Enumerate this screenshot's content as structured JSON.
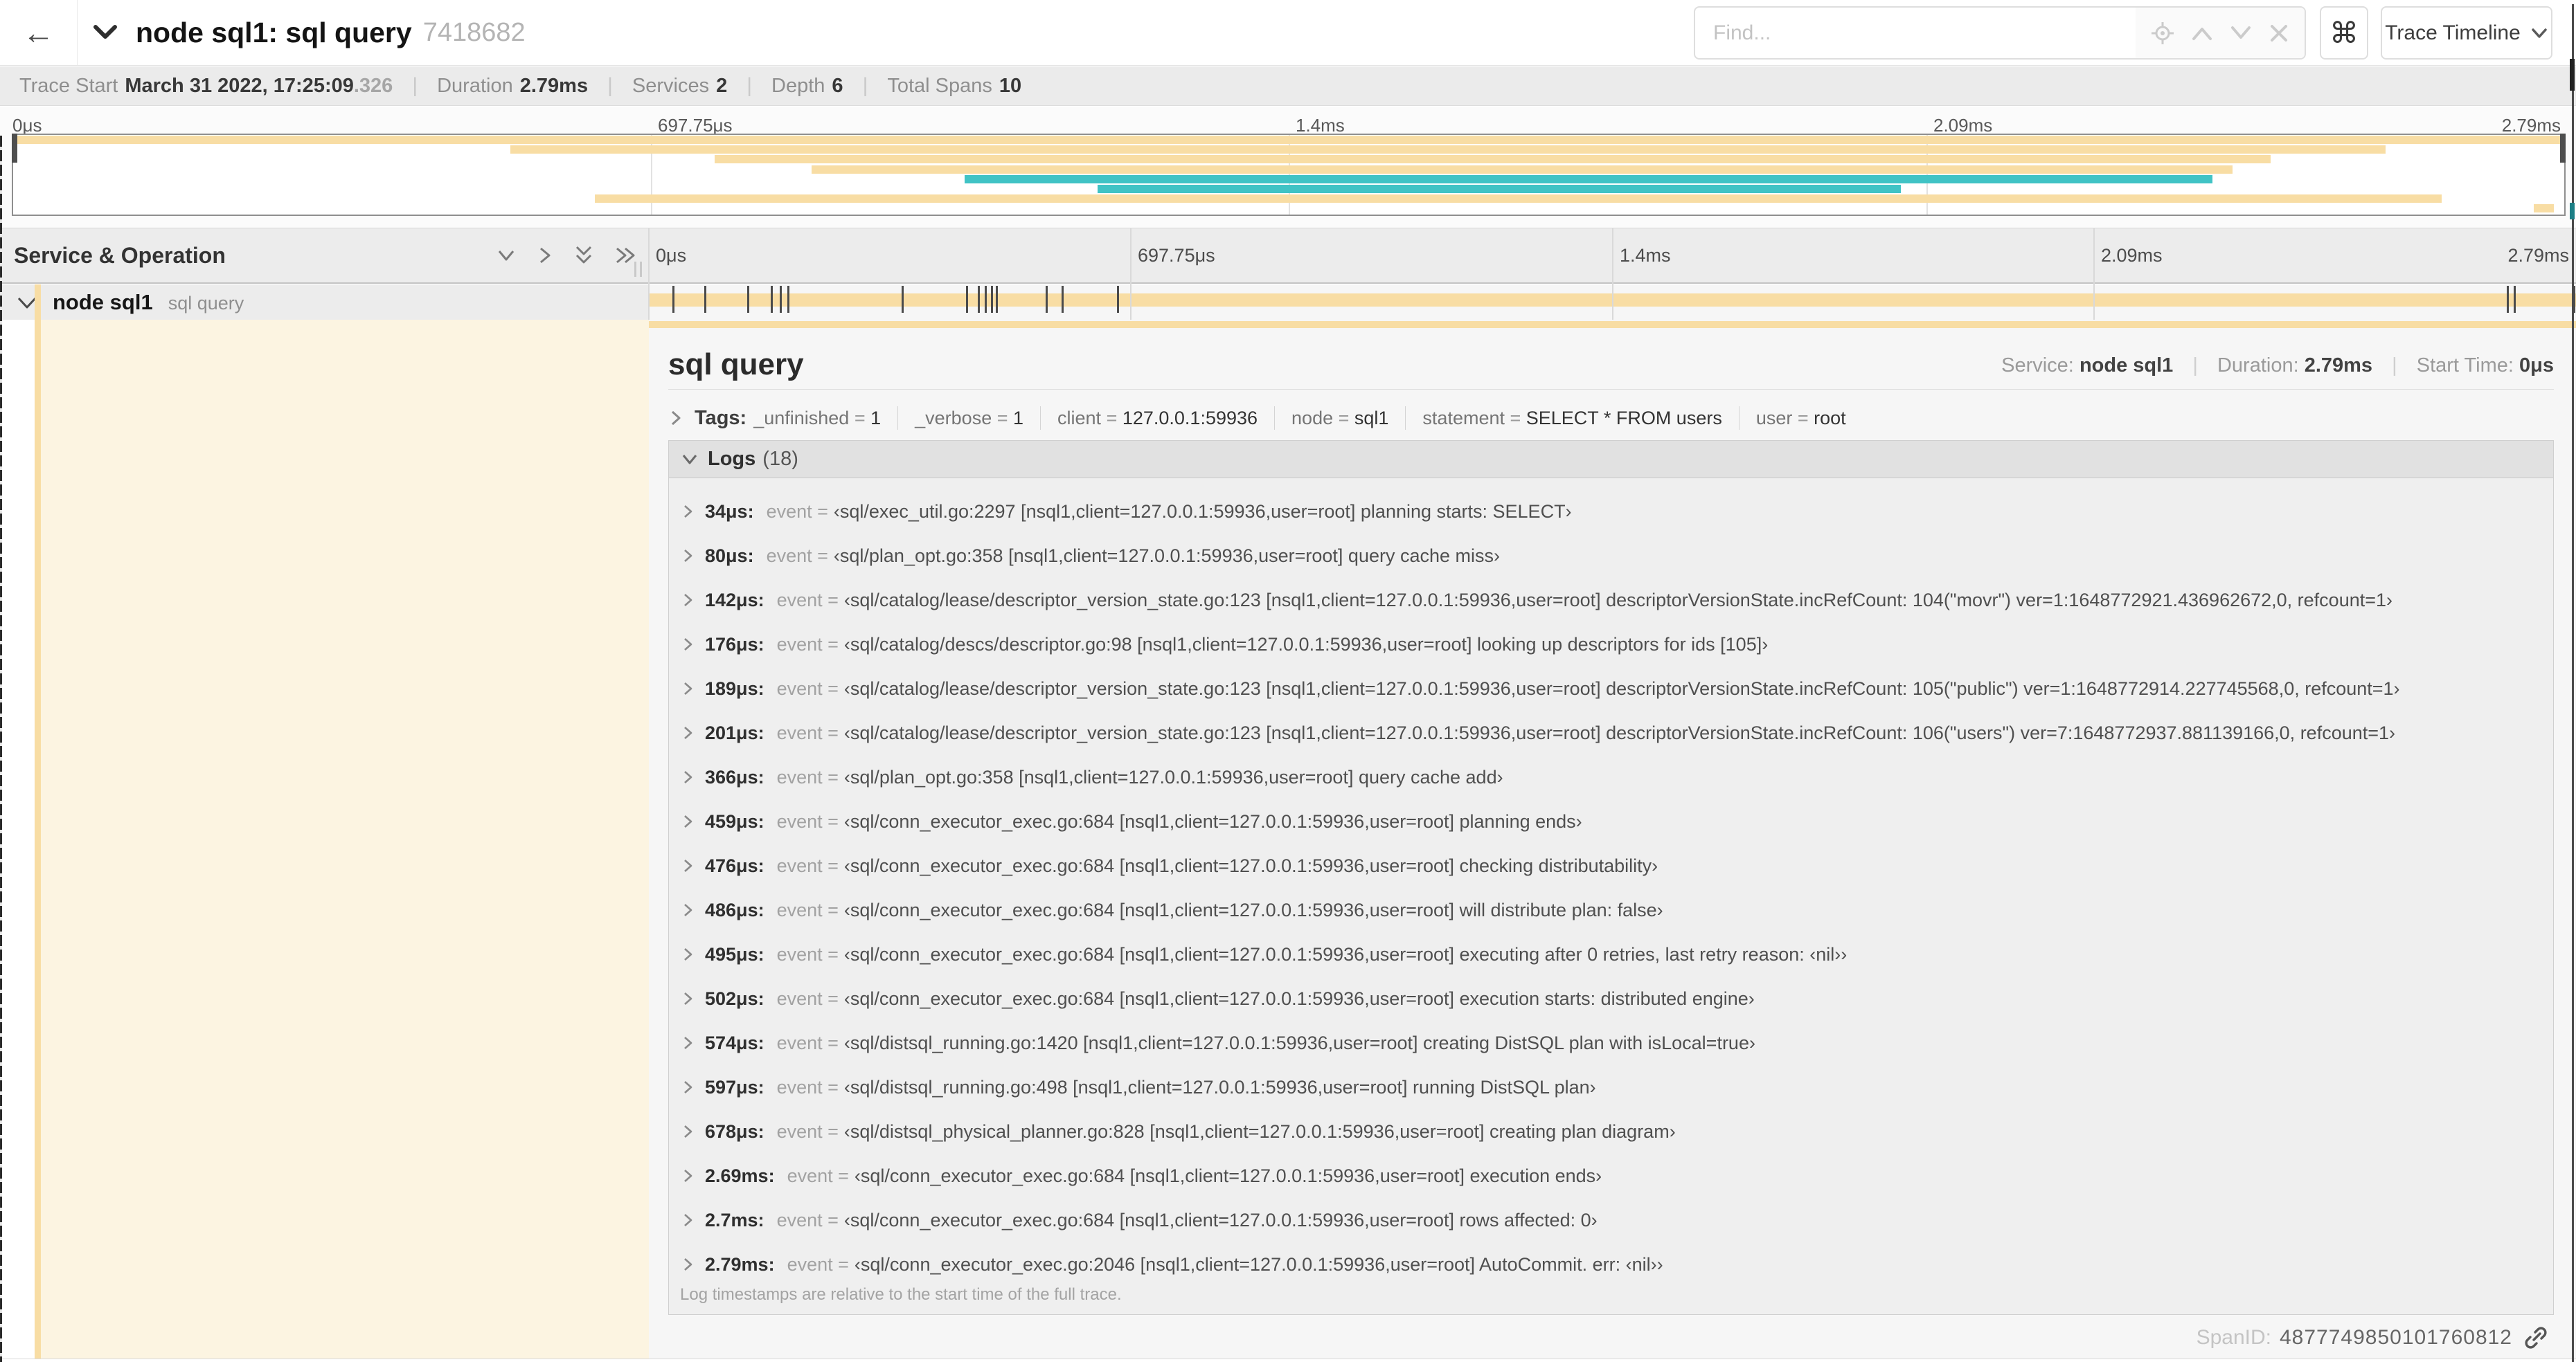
{
  "header": {
    "back": "←",
    "title": "node sql1: sql query",
    "trace_id": "7418682",
    "find_placeholder": "Find...",
    "shortcut": "⌘",
    "view_select": "Trace Timeline"
  },
  "trace_info": {
    "trace_start_label": "Trace Start",
    "trace_start_date": "March 31 2022, 17:25:09",
    "trace_start_frac": ".326",
    "duration_label": "Duration",
    "duration": "2.79ms",
    "services_label": "Services",
    "services": "2",
    "depth_label": "Depth",
    "depth": "6",
    "total_spans_label": "Total Spans",
    "total_spans": "10"
  },
  "minimap": {
    "ticks": [
      "0μs",
      "697.75μs",
      "1.4ms",
      "2.09ms",
      "2.79ms"
    ],
    "spans": [
      {
        "row": 0,
        "start": 0.0,
        "end": 1.0,
        "color": "tan"
      },
      {
        "row": 1,
        "start": 0.195,
        "end": 0.93,
        "color": "tan"
      },
      {
        "row": 2,
        "start": 0.275,
        "end": 0.885,
        "color": "tan"
      },
      {
        "row": 3,
        "start": 0.313,
        "end": 0.87,
        "color": "tan"
      },
      {
        "row": 4,
        "start": 0.373,
        "end": 0.862,
        "color": "teal"
      },
      {
        "row": 5,
        "start": 0.425,
        "end": 0.74,
        "color": "teal"
      },
      {
        "row": 6,
        "start": 0.228,
        "end": 0.952,
        "color": "tan"
      },
      {
        "row": 7,
        "start": 0.988,
        "end": 0.996,
        "color": "tan"
      }
    ]
  },
  "timeline": {
    "left_header": "Service & Operation",
    "ticks": [
      "0μs",
      "697.75μs",
      "1.4ms",
      "2.09ms",
      "2.79ms"
    ]
  },
  "row": {
    "service": "node sql1",
    "operation": "sql query"
  },
  "span_bar": {
    "duration_us": 2790,
    "log_ticks_us": [
      34,
      80,
      142,
      176,
      189,
      201,
      366,
      459,
      476,
      486,
      495,
      502,
      574,
      597,
      678,
      2690,
      2700,
      2786
    ]
  },
  "detail": {
    "title": "sql query",
    "service_label": "Service:",
    "service": "node sql1",
    "duration_label": "Duration:",
    "duration": "2.79ms",
    "start_label": "Start Time:",
    "start": "0μs",
    "tags_label": "Tags:",
    "tags": [
      {
        "key": "_unfinished",
        "value": "1"
      },
      {
        "key": "_verbose",
        "value": "1"
      },
      {
        "key": "client",
        "value": "127.0.0.1:59936"
      },
      {
        "key": "node",
        "value": "sql1"
      },
      {
        "key": "statement",
        "value": "SELECT * FROM users"
      },
      {
        "key": "user",
        "value": "root"
      }
    ],
    "logs_label": "Logs",
    "logs_count": "(18)",
    "event_key": "event",
    "logs": [
      {
        "t": "34μs:",
        "msg": "‹sql/exec_util.go:2297 [nsql1,client=127.0.0.1:59936,user=root] planning starts: SELECT›"
      },
      {
        "t": "80μs:",
        "msg": "‹sql/plan_opt.go:358 [nsql1,client=127.0.0.1:59936,user=root] query cache miss›"
      },
      {
        "t": "142μs:",
        "msg": "‹sql/catalog/lease/descriptor_version_state.go:123 [nsql1,client=127.0.0.1:59936,user=root] descriptorVersionState.incRefCount: 104(\"movr\") ver=1:1648772921.436962672,0, refcount=1›"
      },
      {
        "t": "176μs:",
        "msg": "‹sql/catalog/descs/descriptor.go:98 [nsql1,client=127.0.0.1:59936,user=root] looking up descriptors for ids [105]›"
      },
      {
        "t": "189μs:",
        "msg": "‹sql/catalog/lease/descriptor_version_state.go:123 [nsql1,client=127.0.0.1:59936,user=root] descriptorVersionState.incRefCount: 105(\"public\") ver=1:1648772914.227745568,0, refcount=1›"
      },
      {
        "t": "201μs:",
        "msg": "‹sql/catalog/lease/descriptor_version_state.go:123 [nsql1,client=127.0.0.1:59936,user=root] descriptorVersionState.incRefCount: 106(\"users\") ver=7:1648772937.881139166,0, refcount=1›"
      },
      {
        "t": "366μs:",
        "msg": "‹sql/plan_opt.go:358 [nsql1,client=127.0.0.1:59936,user=root] query cache add›"
      },
      {
        "t": "459μs:",
        "msg": "‹sql/conn_executor_exec.go:684 [nsql1,client=127.0.0.1:59936,user=root] planning ends›"
      },
      {
        "t": "476μs:",
        "msg": "‹sql/conn_executor_exec.go:684 [nsql1,client=127.0.0.1:59936,user=root] checking distributability›"
      },
      {
        "t": "486μs:",
        "msg": "‹sql/conn_executor_exec.go:684 [nsql1,client=127.0.0.1:59936,user=root] will distribute plan: false›"
      },
      {
        "t": "495μs:",
        "msg": "‹sql/conn_executor_exec.go:684 [nsql1,client=127.0.0.1:59936,user=root] executing after 0 retries, last retry reason: ‹nil››"
      },
      {
        "t": "502μs:",
        "msg": "‹sql/conn_executor_exec.go:684 [nsql1,client=127.0.0.1:59936,user=root] execution starts: distributed engine›"
      },
      {
        "t": "574μs:",
        "msg": "‹sql/distsql_running.go:1420 [nsql1,client=127.0.0.1:59936,user=root] creating DistSQL plan with isLocal=true›"
      },
      {
        "t": "597μs:",
        "msg": "‹sql/distsql_running.go:498 [nsql1,client=127.0.0.1:59936,user=root] running DistSQL plan›"
      },
      {
        "t": "678μs:",
        "msg": "‹sql/distsql_physical_planner.go:828 [nsql1,client=127.0.0.1:59936,user=root] creating plan diagram›"
      },
      {
        "t": "2.69ms:",
        "msg": "‹sql/conn_executor_exec.go:684 [nsql1,client=127.0.0.1:59936,user=root] execution ends›"
      },
      {
        "t": "2.7ms:",
        "msg": "‹sql/conn_executor_exec.go:684 [nsql1,client=127.0.0.1:59936,user=root] rows affected: 0›"
      },
      {
        "t": "2.79ms:",
        "msg": "‹sql/conn_executor_exec.go:2046 [nsql1,client=127.0.0.1:59936,user=root] AutoCommit. err: ‹nil››"
      }
    ],
    "footer": "Log timestamps are relative to the start time of the full trace.",
    "span_id_label": "SpanID:",
    "span_id": "4877749850101760812"
  },
  "colors": {
    "tan": "#f8dda4",
    "teal": "#40c3c5",
    "cream": "#fcf4e1",
    "teal_edge": "#1d7f86"
  }
}
